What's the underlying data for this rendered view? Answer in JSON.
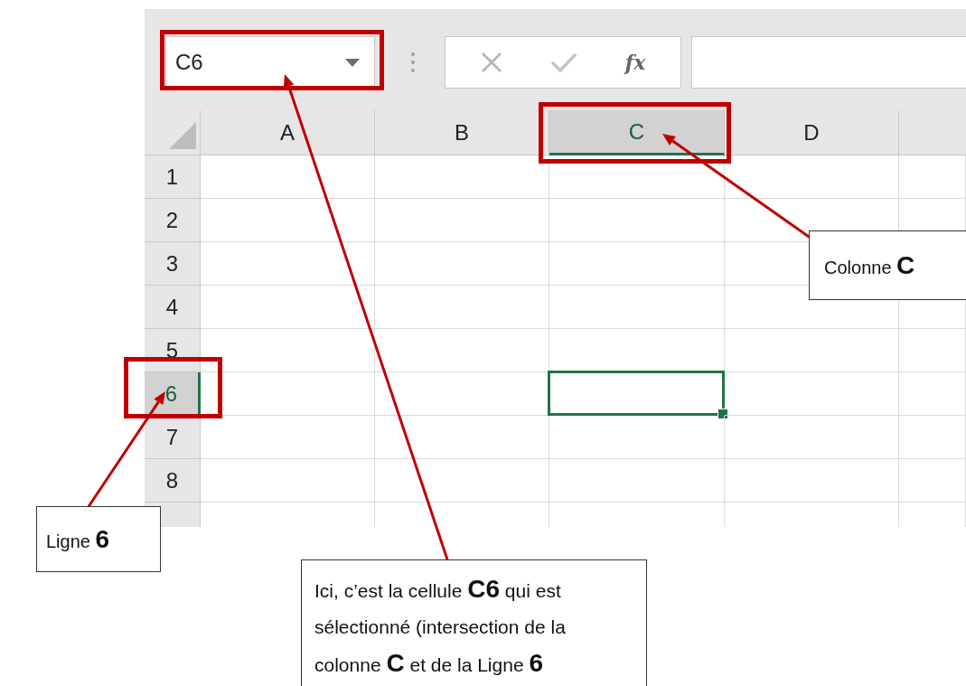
{
  "name_box": {
    "value": "C6"
  },
  "formula_bar": {
    "function_label": "fx"
  },
  "columns": [
    {
      "label": "A",
      "selected": false
    },
    {
      "label": "B",
      "selected": false
    },
    {
      "label": "C",
      "selected": true
    },
    {
      "label": "D",
      "selected": false
    }
  ],
  "rows": [
    {
      "label": "1",
      "selected": false
    },
    {
      "label": "2",
      "selected": false
    },
    {
      "label": "3",
      "selected": false
    },
    {
      "label": "4",
      "selected": false
    },
    {
      "label": "5",
      "selected": false
    },
    {
      "label": "6",
      "selected": true
    },
    {
      "label": "7",
      "selected": false
    },
    {
      "label": "8",
      "selected": false
    }
  ],
  "annotations": [
    {
      "kind": "callout",
      "text": "Colonne **C**"
    },
    {
      "kind": "callout",
      "text": "Ligne **6**"
    },
    {
      "kind": "callout",
      "text": "Ici, c’est la cellule **C6** qui est sélectionné (intersection de la colonne **C** et de la Ligne **6**"
    }
  ]
}
